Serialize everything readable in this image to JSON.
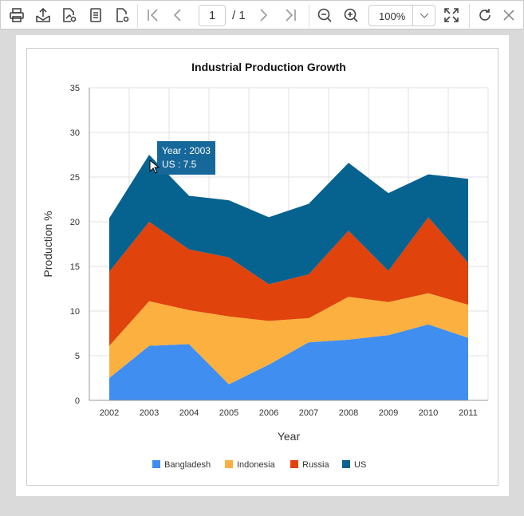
{
  "toolbar": {
    "buttons": [
      {
        "name": "print-button",
        "icon": "printer-icon"
      },
      {
        "name": "export-button",
        "icon": "export-icon"
      },
      {
        "name": "edit-report-button",
        "icon": "edit-report-icon"
      },
      {
        "name": "document-map-button",
        "icon": "document-icon"
      },
      {
        "name": "parameters-button",
        "icon": "file-settings-icon"
      }
    ],
    "page_current": "1",
    "page_total": "/ 1",
    "zoom": "100%"
  },
  "tooltip": {
    "line1": "Year : 2003",
    "line2": "US : 7.5"
  },
  "chart_data": {
    "type": "area",
    "stacked": true,
    "title": "Industrial Production Growth",
    "xlabel": "Year",
    "ylabel": "Production %",
    "categories": [
      "2002",
      "2003",
      "2004",
      "2005",
      "2006",
      "2007",
      "2008",
      "2009",
      "2010",
      "2011"
    ],
    "ylim": [
      0,
      35
    ],
    "yticks": [
      0,
      5,
      10,
      15,
      20,
      25,
      30,
      35
    ],
    "grid": true,
    "legend": "bottom",
    "series": [
      {
        "name": "Bangladesh",
        "color": "#3f8ef0",
        "values": [
          2.5,
          6.1,
          6.3,
          1.8,
          4.0,
          6.5,
          6.8,
          7.3,
          8.5,
          7.0
        ]
      },
      {
        "name": "Indonesia",
        "color": "#fbb040",
        "values": [
          3.6,
          5.0,
          3.8,
          7.6,
          4.9,
          2.7,
          4.8,
          3.7,
          3.5,
          3.7
        ]
      },
      {
        "name": "Russia",
        "color": "#e0430b",
        "values": [
          8.3,
          8.9,
          6.8,
          6.6,
          4.1,
          4.9,
          7.4,
          3.5,
          8.5,
          4.7
        ]
      },
      {
        "name": "US",
        "color": "#06628f",
        "values": [
          6.0,
          7.5,
          6.0,
          6.4,
          7.5,
          7.9,
          7.6,
          8.7,
          4.8,
          9.4
        ]
      }
    ]
  }
}
